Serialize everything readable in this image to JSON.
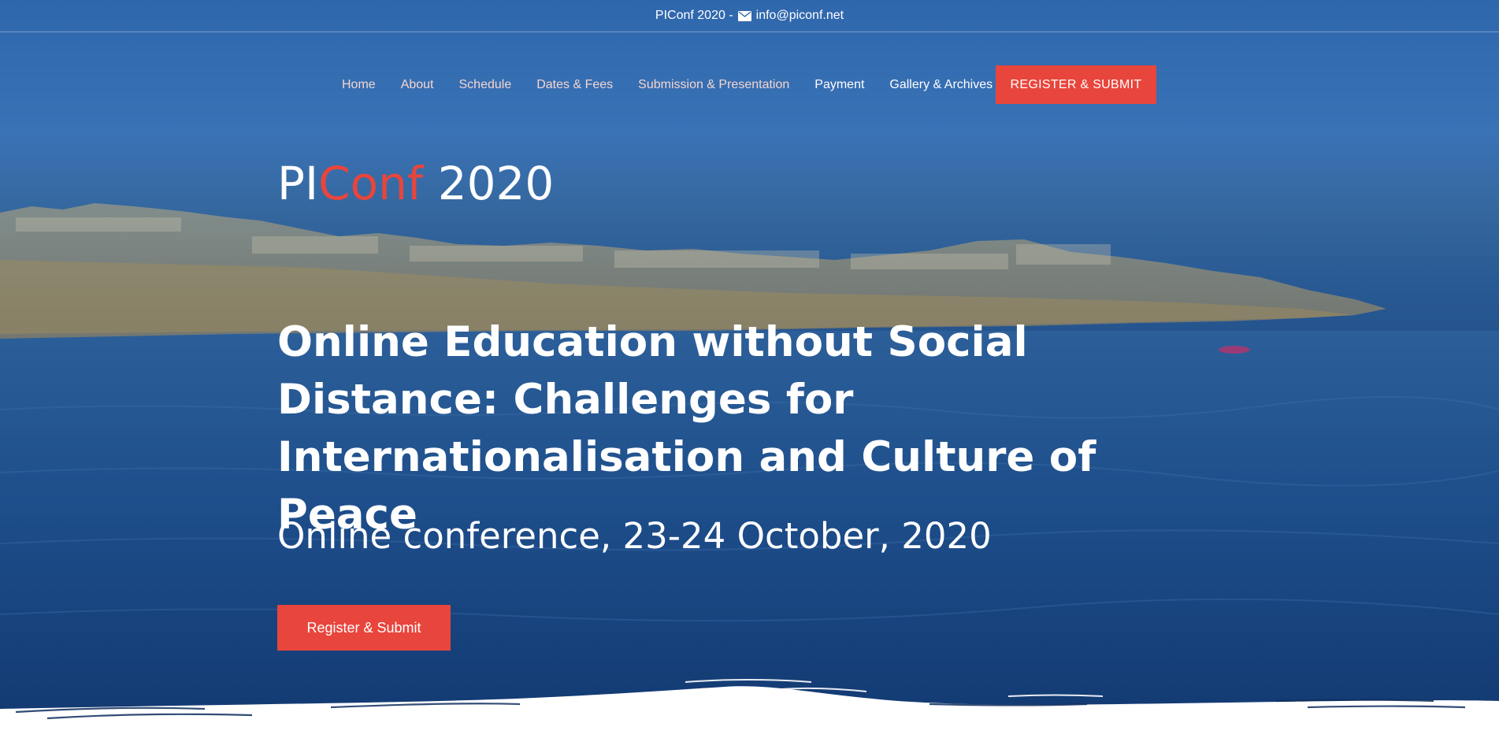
{
  "topbar": {
    "site": "PIConf 2020 -",
    "email": "info@piconf.net",
    "icon": "envelope-icon"
  },
  "nav": {
    "items": [
      {
        "label": "Home"
      },
      {
        "label": "About"
      },
      {
        "label": "Schedule"
      },
      {
        "label": "Dates & Fees"
      },
      {
        "label": "Submission & Presentation"
      },
      {
        "label": "Payment"
      },
      {
        "label": "Gallery & Archives"
      }
    ],
    "cta_label": "REGISTER & SUBMIT"
  },
  "hero": {
    "logo_part1": "PI",
    "logo_part2": "Conf",
    "logo_part3": " 2020",
    "headline": "Online Education without Social Distance: Challenges for Internationalisation and Culture of Peace",
    "subline": "Online conference, 23-24 October, 2020",
    "button_label": "Register & Submit"
  },
  "colors": {
    "accent": "#e8453c",
    "overlay_blue": "#2a5a93",
    "text": "#ffffff"
  }
}
